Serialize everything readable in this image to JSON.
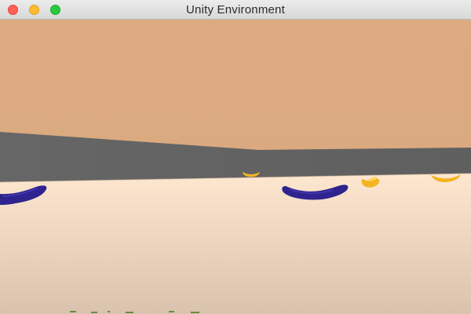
{
  "window": {
    "title": "Unity Environment",
    "controls": {
      "close": "close-window",
      "minimize": "minimize-window",
      "zoom": "zoom-window"
    }
  },
  "scene": {
    "sky_color": "#dcab81",
    "wall_color": "#626262",
    "floor_light": "#fde7cf",
    "floor_shadow": "#dac3ae",
    "blue_banana_color": "#2f238f",
    "yellow_banana_color": "#f4b321"
  }
}
